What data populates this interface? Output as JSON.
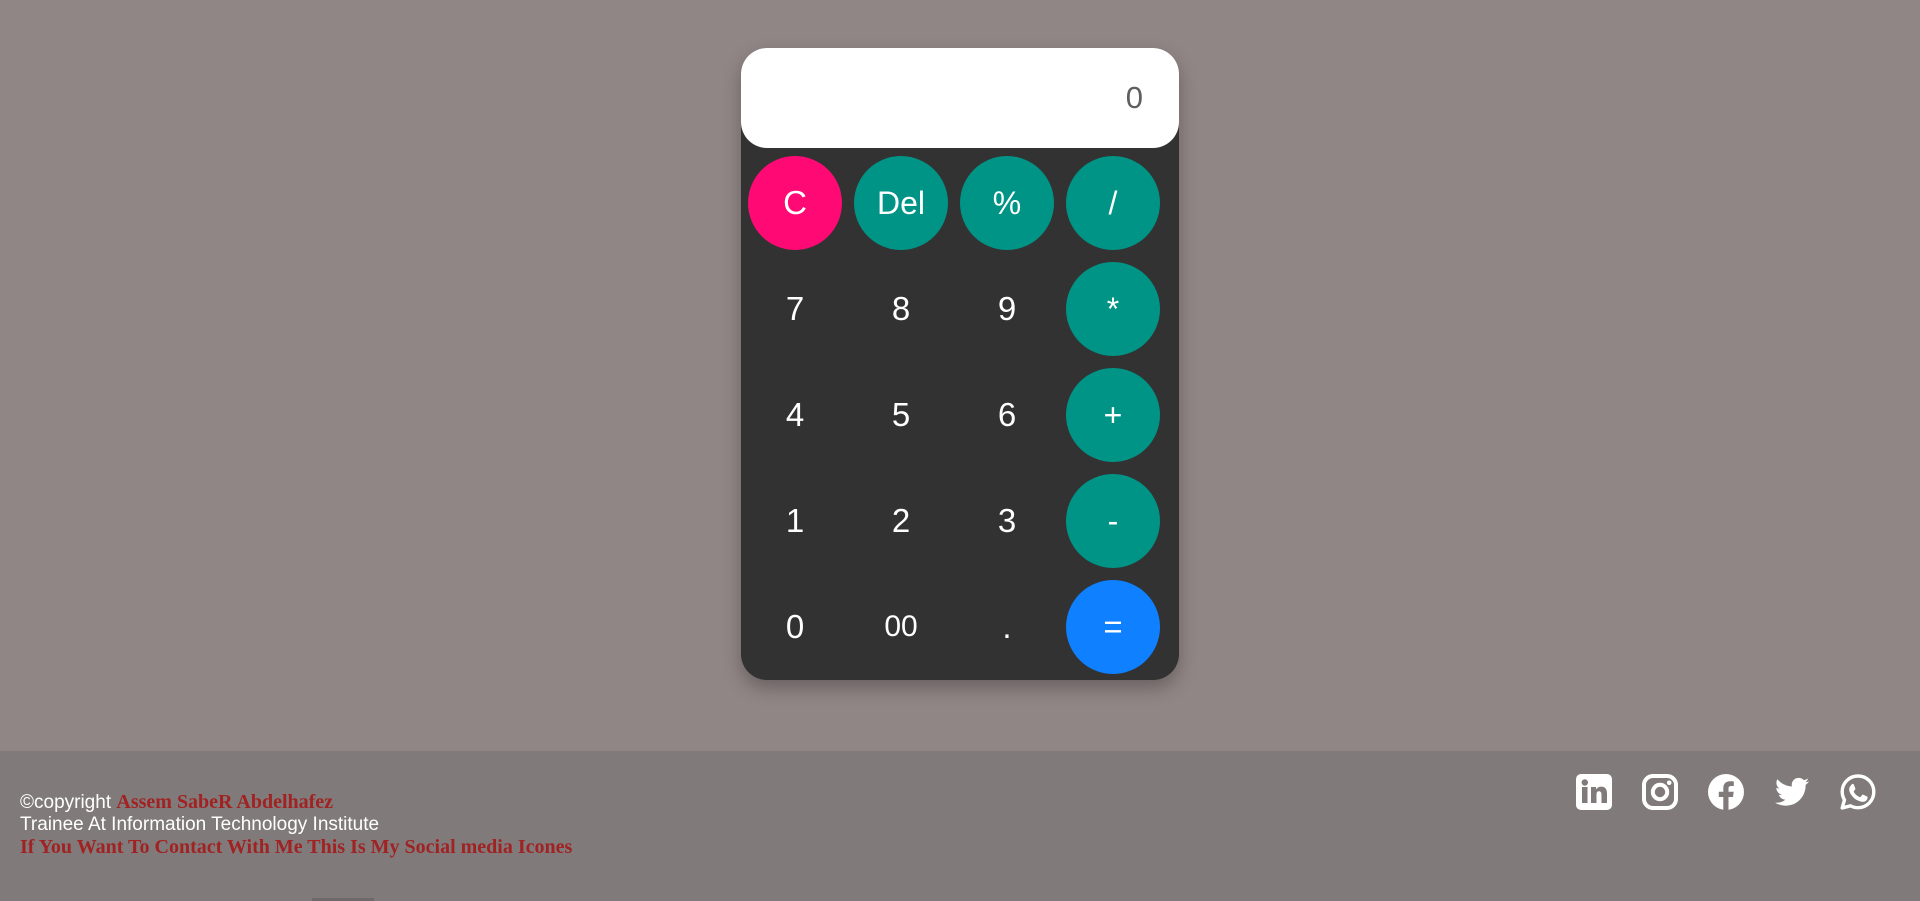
{
  "calculator": {
    "display_value": "0",
    "keys": [
      {
        "id": "clear",
        "label": "C",
        "type": "clear"
      },
      {
        "id": "delete",
        "label": "Del",
        "type": "op"
      },
      {
        "id": "percent",
        "label": "%",
        "type": "op"
      },
      {
        "id": "divide",
        "label": "/",
        "type": "op"
      },
      {
        "id": "seven",
        "label": "7",
        "type": "num"
      },
      {
        "id": "eight",
        "label": "8",
        "type": "num"
      },
      {
        "id": "nine",
        "label": "9",
        "type": "num"
      },
      {
        "id": "multiply",
        "label": "*",
        "type": "op"
      },
      {
        "id": "four",
        "label": "4",
        "type": "num"
      },
      {
        "id": "five",
        "label": "5",
        "type": "num"
      },
      {
        "id": "six",
        "label": "6",
        "type": "num"
      },
      {
        "id": "plus",
        "label": "+",
        "type": "op"
      },
      {
        "id": "one",
        "label": "1",
        "type": "num"
      },
      {
        "id": "two",
        "label": "2",
        "type": "num"
      },
      {
        "id": "three",
        "label": "3",
        "type": "num"
      },
      {
        "id": "minus",
        "label": "-",
        "type": "op"
      },
      {
        "id": "zero",
        "label": "0",
        "type": "num"
      },
      {
        "id": "double-zero",
        "label": "00",
        "type": "num"
      },
      {
        "id": "decimal",
        "label": ".",
        "type": "num"
      },
      {
        "id": "equals",
        "label": "=",
        "type": "eq"
      }
    ]
  },
  "footer": {
    "copyright_prefix": "©copyright",
    "author_name": "Assem SabeR Abdelhafez",
    "subtitle": "Trainee At Information Technology Institute",
    "contact_text": "If You Want To Contact With Me This Is My Social media Icones",
    "socials": [
      {
        "name": "LinkedIn",
        "icon": "linkedin-icon"
      },
      {
        "name": "Instagram",
        "icon": "instagram-icon"
      },
      {
        "name": "Facebook",
        "icon": "facebook-icon"
      },
      {
        "name": "Twitter",
        "icon": "twitter-icon"
      },
      {
        "name": "WhatsApp",
        "icon": "whatsapp-icon"
      }
    ]
  },
  "colors": {
    "page_background": "#918686",
    "calculator_body": "#323232",
    "operator_key": "#009487",
    "clear_key": "#ff0a75",
    "equals_key": "#0f80ff",
    "footer_background": "#807a7a",
    "accent_text": "#a12222"
  }
}
